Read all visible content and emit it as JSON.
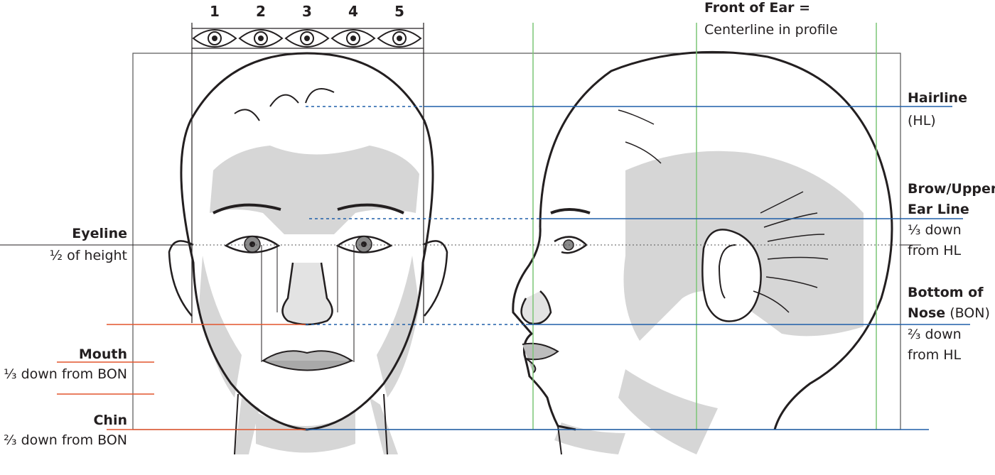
{
  "eye_widths": [
    "1",
    "2",
    "3",
    "4",
    "5"
  ],
  "left_labels": {
    "eyeline_title": "Eyeline",
    "eyeline_desc": "½ of height",
    "mouth_title": "Mouth",
    "mouth_desc": "⅓ down from BON",
    "chin_title": "Chin",
    "chin_desc": "⅔ down from BON"
  },
  "right_labels": {
    "hairline_title": "Hairline",
    "hairline_desc": "(HL)",
    "brow_title_1": "Brow/Upper",
    "brow_title_2": "Ear Line",
    "brow_desc_1": "⅓ down",
    "brow_desc_2": "from HL",
    "nose_title_1": "Bottom of",
    "nose_title_2": "Nose",
    "nose_abbr": " (BON)",
    "nose_desc_1": "⅔ down",
    "nose_desc_2": "from HL"
  },
  "top_labels": {
    "ear_title": "Front of Ear =",
    "ear_desc": "Centerline in profile"
  },
  "colors": {
    "blue_guide": "#1f5fa8",
    "red_guide": "#e2552d",
    "green_guide": "#7cc576",
    "shading": "#c9c9c9",
    "ink": "#231f20"
  }
}
